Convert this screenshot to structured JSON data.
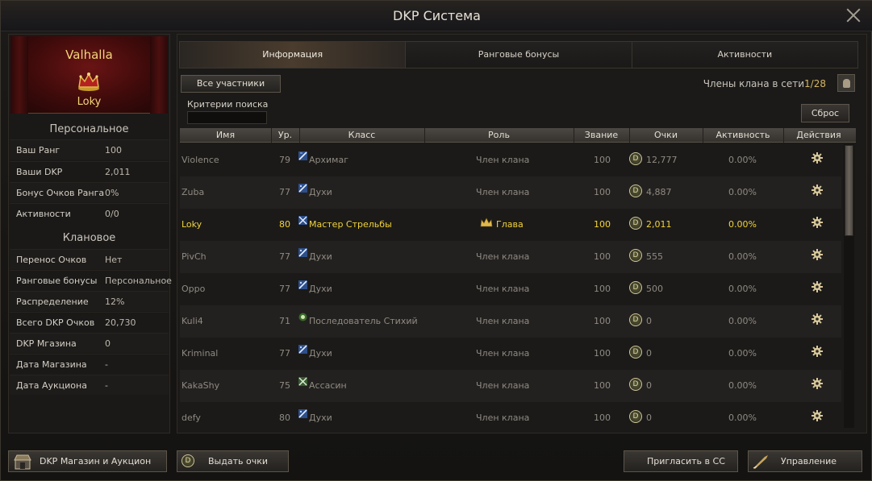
{
  "window": {
    "title": "DKP Система"
  },
  "clan": {
    "name": "Valhalla",
    "leader": "Loky"
  },
  "personal": {
    "heading": "Персональное",
    "rows": [
      {
        "label": "Ваш Ранг",
        "value": "100"
      },
      {
        "label": "Ваши DKP",
        "value": "2,011"
      },
      {
        "label": "Бонус Очков Ранга",
        "value": "0%"
      },
      {
        "label": "Активности",
        "value": "0/0"
      }
    ]
  },
  "clan_stats": {
    "heading": "Клановое",
    "rows": [
      {
        "label": "Перенос Очков",
        "value": "Нет"
      },
      {
        "label": "Ранговые бонусы",
        "value": "Персональное"
      },
      {
        "label": "Распределение",
        "value": "12%"
      },
      {
        "label": "Всего DKP Очков",
        "value": "20,730"
      },
      {
        "label": "DKP Мгазина",
        "value": "0"
      },
      {
        "label": "Дата Магазина",
        "value": "-"
      },
      {
        "label": "Дата Аукциона",
        "value": "-"
      }
    ]
  },
  "tabs": [
    {
      "label": "Информация",
      "active": true
    },
    {
      "label": "Ранговые бонусы",
      "active": false
    },
    {
      "label": "Активности",
      "active": false
    }
  ],
  "filter": {
    "all_members": "Все участники",
    "search_label": "Критерии поиска",
    "search_value": "",
    "reset": "Сброс"
  },
  "online": {
    "label": "Члены клана в сети",
    "count": "1/28"
  },
  "columns": [
    "Имя",
    "Ур.",
    "Класс",
    "Роль",
    "Звание",
    "Очки",
    "Активность",
    "Действия"
  ],
  "members": [
    {
      "name": "Violence",
      "level": "79",
      "class": "Архимаг",
      "class_icon": "class-archmage-icon",
      "role": "Член клана",
      "rank": "100",
      "points": "12,777",
      "activity": "0.00%"
    },
    {
      "name": "Zuba",
      "level": "77",
      "class": "Духи",
      "class_icon": "class-spirit-icon",
      "role": "Член клана",
      "rank": "100",
      "points": "4,887",
      "activity": "0.00%"
    },
    {
      "name": "Loky",
      "level": "80",
      "class": "Мастер Стрельбы",
      "class_icon": "class-gunmaster-icon",
      "role": "Глава",
      "rank": "100",
      "points": "2,011",
      "activity": "0.00%",
      "self": true
    },
    {
      "name": "PivCh",
      "level": "77",
      "class": "Духи",
      "class_icon": "class-spirit-icon",
      "role": "Член клана",
      "rank": "100",
      "points": "555",
      "activity": "0.00%"
    },
    {
      "name": "Oppo",
      "level": "77",
      "class": "Духи",
      "class_icon": "class-spirit-icon",
      "role": "Член клана",
      "rank": "100",
      "points": "500",
      "activity": "0.00%"
    },
    {
      "name": "Kuli4",
      "level": "71",
      "class": "Последователь Стихий",
      "class_icon": "class-elementalist-icon",
      "role": "Член клана",
      "rank": "100",
      "points": "0",
      "activity": "0.00%"
    },
    {
      "name": "Kriminal",
      "level": "77",
      "class": "Духи",
      "class_icon": "class-spirit-icon",
      "role": "Член клана",
      "rank": "100",
      "points": "0",
      "activity": "0.00%"
    },
    {
      "name": "KakaShy",
      "level": "75",
      "class": "Ассасин",
      "class_icon": "class-assassin-icon",
      "role": "Член клана",
      "rank": "100",
      "points": "0",
      "activity": "0.00%"
    },
    {
      "name": "defy",
      "level": "80",
      "class": "Духи",
      "class_icon": "class-spirit-icon",
      "role": "Член клана",
      "rank": "100",
      "points": "0",
      "activity": "0.00%"
    }
  ],
  "coin_letter": "D",
  "footer": {
    "shop": "DKP Магазин и Аукцион",
    "give_points": "Выдать очки",
    "invite": "Пригласить в СС",
    "manage": "Управление"
  },
  "colors": {
    "highlight": "#f2d33a",
    "gold": "#f2d57a",
    "banner": "#6a1414"
  }
}
